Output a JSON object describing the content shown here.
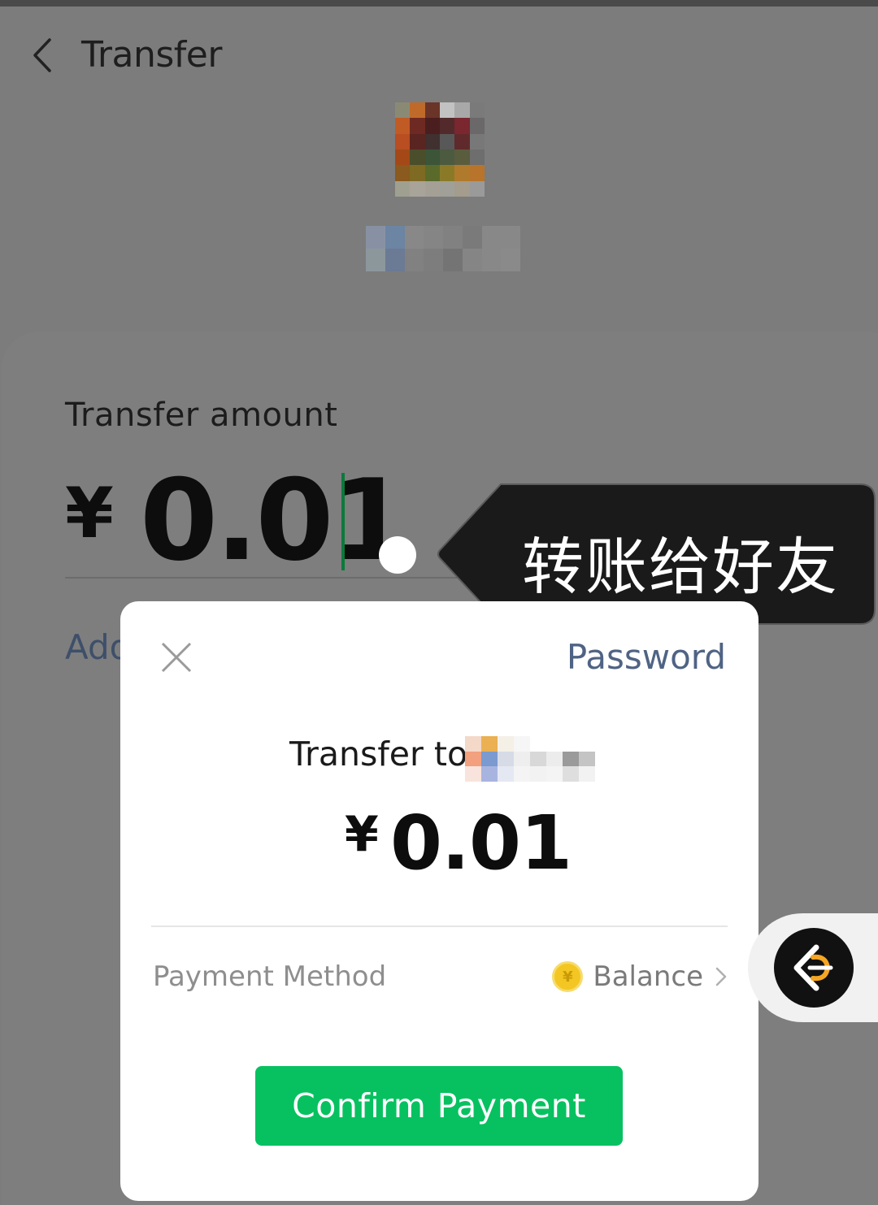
{
  "header": {
    "title": "Transfer",
    "back_icon": "chevron-left-icon"
  },
  "recipient": {
    "avatar_icon": "avatar-pixelated"
  },
  "amount_section": {
    "label": "Transfer amount",
    "currency": "¥",
    "amount": "0.01",
    "add_note": "Add"
  },
  "tooltip": {
    "text": "转账给好友"
  },
  "payment_dialog": {
    "close_icon": "close-icon",
    "password_link": "Password",
    "transfer_to": "Transfer to",
    "currency": "¥",
    "amount": "0.01",
    "payment_method_label": "Payment Method",
    "payment_method_value": "Balance",
    "payment_method_icon": "yuan-coin-icon",
    "confirm_button": "Confirm Payment"
  },
  "floating_button": {
    "icon": "assistant-logo-icon"
  },
  "colors": {
    "accent_green": "#07c160",
    "link_blue": "#4f6384",
    "overlay_gray": "#7c7c7c",
    "caret_green": "#0b7a3c",
    "coin_yellow": "#f3c623"
  }
}
